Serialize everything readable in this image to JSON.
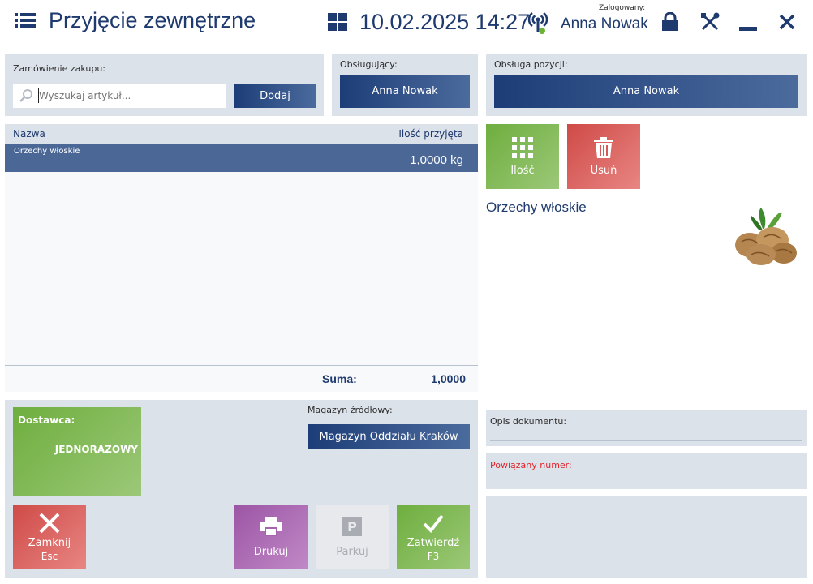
{
  "header": {
    "title": "Przyjęcie zewnętrzne",
    "datetime": "10.02.2025 14:27",
    "logged_in_label": "Zalogowany:",
    "user": "Anna Nowak"
  },
  "order": {
    "label": "Zamówienie zakupu:",
    "search_placeholder": "Wyszukaj artykuł...",
    "add_label": "Dodaj"
  },
  "handler": {
    "label": "Obsługujący:",
    "value": "Anna Nowak"
  },
  "position_handler": {
    "label": "Obsługa pozycji:",
    "value": "Anna Nowak"
  },
  "table": {
    "col_name": "Nazwa",
    "col_qty": "Ilość przyjęta",
    "rows": [
      {
        "name": "Orzechy włoskie",
        "qty": "1,0000 kg"
      }
    ],
    "sum_label": "Suma:",
    "sum_value": "1,0000"
  },
  "actions_right": {
    "qty_label": "Ilość",
    "delete_label": "Usuń"
  },
  "item_details": {
    "name": "Orzechy włoskie"
  },
  "supplier": {
    "label": "Dostawca:",
    "value": "JEDNORAZOWY"
  },
  "source_warehouse": {
    "label": "Magazyn źródłowy:",
    "value": "Magazyn Oddziału Kraków"
  },
  "doc_desc": {
    "label": "Opis dokumentu:"
  },
  "linked_number": {
    "label": "Powiązany numer:"
  },
  "bottom_buttons": {
    "close": "Zamknij",
    "close_key": "Esc",
    "print": "Drukuj",
    "park": "Parkuj",
    "confirm": "Zatwierdź",
    "confirm_key": "F3"
  },
  "colors": {
    "accent_blue": "#1d3d78",
    "green": "#7db84a",
    "red": "#d9544f",
    "purple": "#a05ea8",
    "panel_bg": "#dce2ea",
    "required_red": "#e0262b"
  }
}
